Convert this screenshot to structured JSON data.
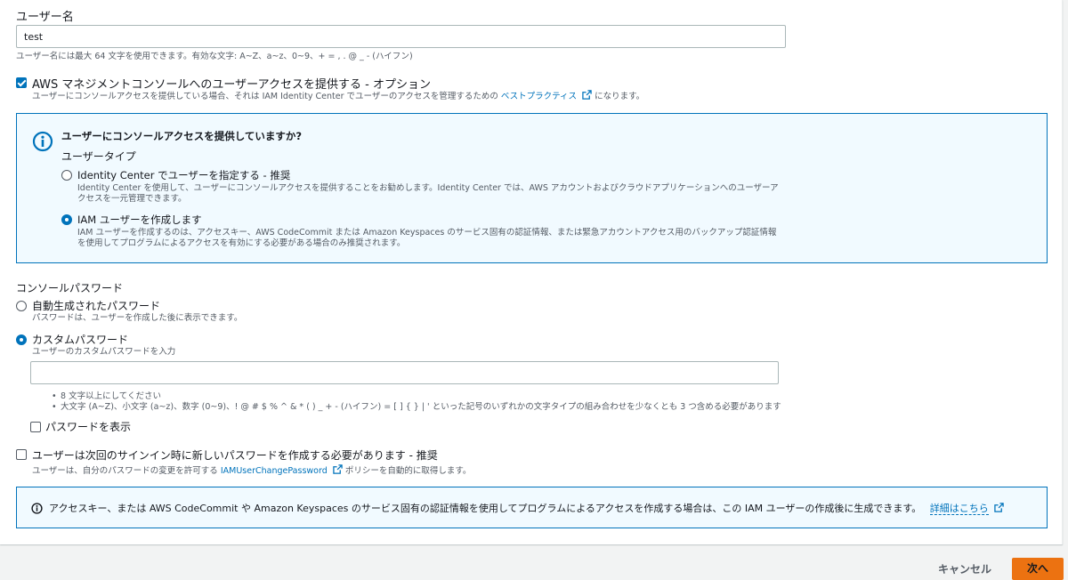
{
  "username": {
    "label": "ユーザー名",
    "value": "test",
    "hint": "ユーザー名には最大 64 文字を使用できます。有効な文字: A~Z、a~z、0~9、+ = , . @ _ - (ハイフン)"
  },
  "console_access": {
    "checked": true,
    "label": "AWS マネジメントコンソールへのユーザーアクセスを提供する - オプション",
    "desc_pre": "ユーザーにコンソールアクセスを提供している場合、それは IAM Identity Center でユーザーのアクセスを管理するための",
    "desc_link": "ベストプラクティス",
    "desc_post": "になります。"
  },
  "info_panel": {
    "title": "ユーザーにコンソールアクセスを提供していますか?",
    "user_type_label": "ユーザータイプ",
    "options": [
      {
        "label": "Identity Center でユーザーを指定する - 推奨",
        "desc_line1": "Identity Center を使用して、ユーザーにコンソールアクセスを提供することをお勧めします。Identity Center では、AWS アカウントおよびクラウドアプリケーションへのユーザーア",
        "desc_line2": "クセスを一元管理できます。",
        "selected": false
      },
      {
        "label": "IAM ユーザーを作成します",
        "desc_line1": "IAM ユーザーを作成するのは、アクセスキー、AWS CodeCommit または Amazon Keyspaces のサービス固有の認証情報、または緊急アカウントアクセス用のバックアップ認証情報",
        "desc_line2": "を使用してプログラムによるアクセスを有効にする必要がある場合のみ推奨されます。",
        "selected": true
      }
    ]
  },
  "password": {
    "section_label": "コンソールパスワード",
    "auto": {
      "label": "自動生成されたパスワード",
      "desc": "パスワードは、ユーザーを作成した後に表示できます。",
      "selected": false
    },
    "custom": {
      "label": "カスタムパスワード",
      "desc": "ユーザーのカスタムパスワードを入力",
      "selected": true,
      "value": ""
    },
    "requirements": [
      "8 文字以上にしてください",
      "大文字 (A~Z)、小文字 (a~z)、数字 (0~9)、! @ # $ % ^ & * ( ) _ + - (ハイフン) = [ ] { } | ' といった記号のいずれかの文字タイプの組み合わせを少なくとも 3 つ含める必要があります"
    ],
    "show_password_label": "パスワードを表示",
    "show_password_checked": false
  },
  "reset_required": {
    "checked": false,
    "label": "ユーザーは次回のサインイン時に新しいパスワードを作成する必要があります - 推奨",
    "desc_pre": "ユーザーは、自分のパスワードの変更を許可する",
    "desc_link": "IAMUserChangePassword",
    "desc_post": "ポリシーを自動的に取得します。"
  },
  "bottom_info": {
    "text": "アクセスキー、または AWS CodeCommit や Amazon Keyspaces のサービス固有の認証情報を使用してプログラムによるアクセスを作成する場合は、この IAM ユーザーの作成後に生成できます。",
    "link": "詳細はこちら"
  },
  "footer": {
    "cancel_label": "キャンセル",
    "next_label": "次へ"
  },
  "colors": {
    "accent": "#0073bb",
    "primary_button": "#ec7211",
    "info_bg": "#f1faff"
  }
}
